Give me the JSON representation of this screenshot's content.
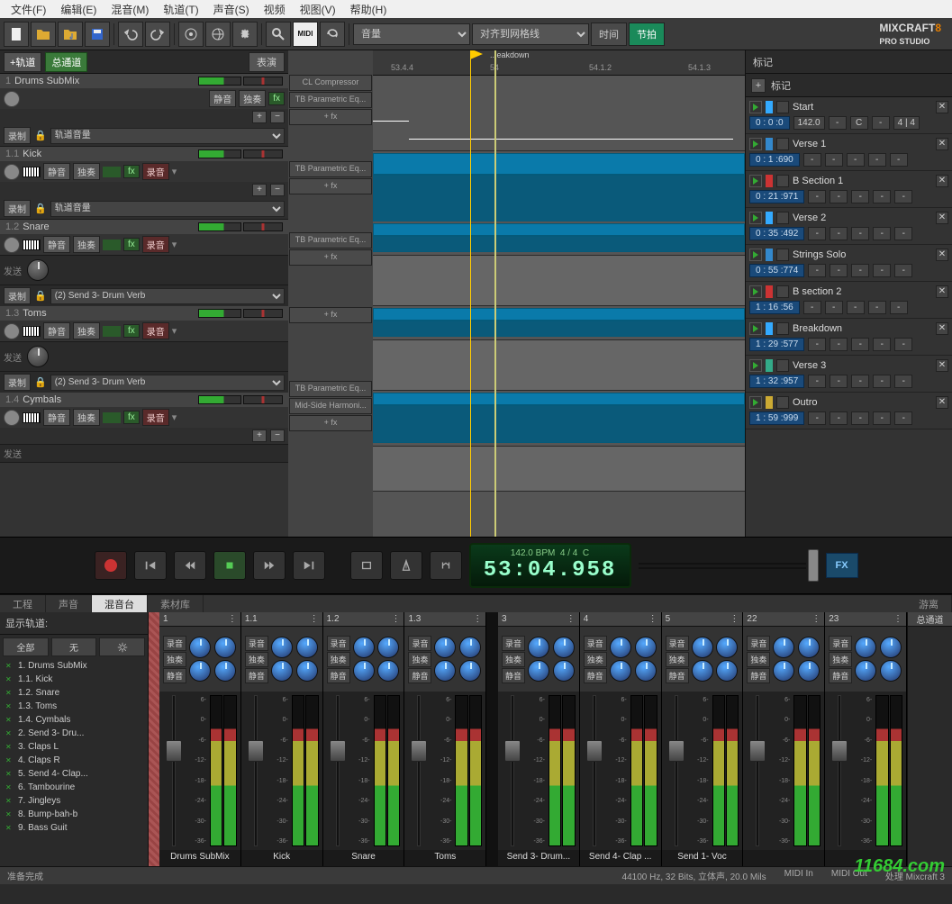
{
  "menu": [
    "文件(F)",
    "编辑(E)",
    "混音(M)",
    "轨道(T)",
    "声音(S)",
    "视频",
    "视图(V)",
    "帮助(H)"
  ],
  "toolbar": {
    "select_volume": "音量",
    "select_snap": "对齐到网格线",
    "time_label": "时间",
    "beat_label": "节拍",
    "logo_a": "MIXCRAFT",
    "logo_b": "8",
    "logo_c": "PRO STUDIO"
  },
  "track_header": {
    "plus": "+轨道",
    "master": "总通道",
    "perform": "表演"
  },
  "tracks": [
    {
      "num": "1",
      "name": "Drums SubMix",
      "mute": "静音",
      "solo": "独奏",
      "fx": "fx",
      "arm": "录制",
      "routing": "轨道音量",
      "fx_slots": [
        "CL Compressor",
        "TB Parametric Eq...",
        "+ fx"
      ]
    },
    {
      "num": "1.1",
      "name": "Kick",
      "mute": "静音",
      "solo": "独奏",
      "fx": "fx",
      "rec": "录音",
      "arm": "录制",
      "routing": "轨道音量",
      "fx_slots": [
        "TB Parametric Eq...",
        "+ fx"
      ]
    },
    {
      "num": "1.2",
      "name": "Snare",
      "mute": "静音",
      "solo": "独奏",
      "fx": "fx",
      "rec": "录音",
      "fx_slots": [
        "TB Parametric Eq...",
        "+ fx"
      ]
    },
    {
      "send1_label": "发送",
      "send1_arm": "录制",
      "send1_routing": "(2) Send 3- Drum Verb"
    },
    {
      "num": "1.3",
      "name": "Toms",
      "mute": "静音",
      "solo": "独奏",
      "fx": "fx",
      "rec": "录音",
      "fx_slots": [
        "+ fx"
      ]
    },
    {
      "send2_label": "发送",
      "send2_arm": "录制",
      "send2_routing": "(2) Send 3- Drum Verb"
    },
    {
      "num": "1.4",
      "name": "Cymbals",
      "mute": "静音",
      "solo": "独奏",
      "fx": "fx",
      "rec": "录音",
      "fx_slots": [
        "TB Parametric Eq...",
        "Mid-Side Harmoni...",
        "+ fx"
      ]
    }
  ],
  "ruler": {
    "marks": [
      "53.4.4",
      "54",
      "54.1.2",
      "54.1.3"
    ],
    "flag": "...eakdown"
  },
  "markers_panel": {
    "title": "标记",
    "plus": "+",
    "tab": "标记",
    "items": [
      {
        "name": "Start",
        "time": "0 : 0 :0",
        "tempo": "142.0",
        "key": "C",
        "sig": "4 | 4",
        "color": "#3af"
      },
      {
        "name": "Verse 1",
        "time": "0 : 1 :690",
        "color": "#38c"
      },
      {
        "name": "B Section 1",
        "time": "0 : 21 :971",
        "color": "#c33"
      },
      {
        "name": "Verse 2",
        "time": "0 : 35 :492",
        "color": "#3af"
      },
      {
        "name": "Strings Solo",
        "time": "0 : 55 :774",
        "color": "#38c"
      },
      {
        "name": "B section 2",
        "time": "1 : 16 :56",
        "color": "#c33"
      },
      {
        "name": "Breakdown",
        "time": "1 : 29 :577",
        "color": "#3af"
      },
      {
        "name": "Verse 3",
        "time": "1 : 32 :957",
        "color": "#3a8"
      },
      {
        "name": "Outro",
        "time": "1 : 59 :999",
        "color": "#ca3"
      }
    ]
  },
  "transport": {
    "bpm": "142.0 BPM",
    "sig": "4 / 4",
    "key": "C",
    "counter": "53:04.958",
    "fx": "FX"
  },
  "bottom_tabs": [
    "工程",
    "声音",
    "混音台",
    "素材库"
  ],
  "mixer": {
    "show_label": "显示轨道:",
    "all": "全部",
    "none": "无",
    "master": "总通道",
    "sep": "游离",
    "list": [
      "1. Drums SubMix",
      "1.1. Kick",
      "1.2. Snare",
      "1.3. Toms",
      "1.4. Cymbals",
      "2. Send 3- Dru...",
      "3. Claps L",
      "4. Claps R",
      "5. Send 4- Clap...",
      "6. Tambourine",
      "7. Jingleys",
      "8. Bump-bah-b",
      "9. Bass Guit"
    ],
    "strip_btns": {
      "solo": "独奏",
      "mute": "静音",
      "rec": "录音"
    },
    "strips": [
      {
        "num": "1",
        "label": "Drums SubMix"
      },
      {
        "num": "1.1",
        "label": "Kick"
      },
      {
        "num": "1.2",
        "label": "Snare"
      },
      {
        "num": "1.3",
        "label": "Toms"
      },
      {
        "num": "3",
        "label": "Send 3- Drum..."
      },
      {
        "num": "4",
        "label": "Send 4- Clap ..."
      },
      {
        "num": "5",
        "label": "Send 1- Voc"
      },
      {
        "num": "22",
        "label": ""
      },
      {
        "num": "23",
        "label": ""
      }
    ],
    "scale": [
      "6-",
      "0-",
      "-6-",
      "-12-",
      "-18-",
      "-24-",
      "-30-",
      "-36-"
    ]
  },
  "status": {
    "ready": "准备完成",
    "audio": "44100 Hz, 32 Bits, 立体声, 20.0 Mils",
    "midi_in": "MIDI In",
    "midi_out": "MIDI Out",
    "proc": "处理 Mixcraft 3"
  },
  "watermark": "11684.com"
}
